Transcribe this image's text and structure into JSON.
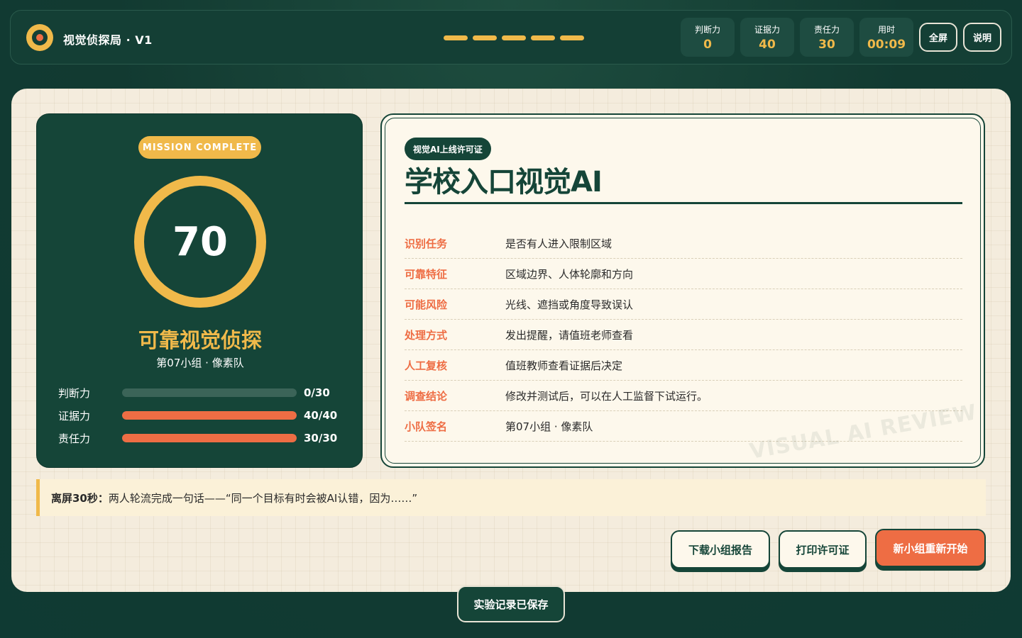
{
  "header": {
    "app_title": "视觉侦探局 · V1",
    "progress_steps": 5,
    "stats": [
      {
        "label": "判断力",
        "value": "0"
      },
      {
        "label": "证据力",
        "value": "40"
      },
      {
        "label": "责任力",
        "value": "30"
      },
      {
        "label": "用时",
        "value": "00:09"
      }
    ],
    "fullscreen_label": "全屏",
    "help_label": "说明"
  },
  "score_panel": {
    "badge": "MISSION COMPLETE",
    "score": "70",
    "score_fraction": 0.7,
    "rank_title": "可靠视觉侦探",
    "team_line": "第07小组 · 像素队",
    "bars": [
      {
        "label": "判断力",
        "value": 0,
        "max": 30,
        "text": "0/30"
      },
      {
        "label": "证据力",
        "value": 40,
        "max": 40,
        "text": "40/40"
      },
      {
        "label": "责任力",
        "value": 30,
        "max": 30,
        "text": "30/30"
      }
    ]
  },
  "license": {
    "badge": "视觉AI上线许可证",
    "title": "学校入口视觉AI",
    "rows": [
      {
        "key": "识别任务",
        "value": "是否有人进入限制区域"
      },
      {
        "key": "可靠特征",
        "value": "区域边界、人体轮廓和方向"
      },
      {
        "key": "可能风险",
        "value": "光线、遮挡或角度导致误认"
      },
      {
        "key": "处理方式",
        "value": "发出提醒，请值班老师查看"
      },
      {
        "key": "人工复核",
        "value": "值班教师查看证据后决定"
      },
      {
        "key": "调查结论",
        "value": "修改并测试后，可以在人工监督下试运行。"
      },
      {
        "key": "小队签名",
        "value": "第07小组 · 像素队"
      }
    ],
    "watermark": "VISUAL AI REVIEW"
  },
  "tip": {
    "label": "离屏30秒：",
    "text": "两人轮流完成一句话——“同一个目标有时会被AI认错，因为……”"
  },
  "actions": {
    "download": "下载小组报告",
    "print": "打印许可证",
    "restart": "新小组重新开始"
  },
  "toast": "实验记录已保存",
  "colors": {
    "accent_yellow": "#f0b94a",
    "accent_orange": "#ee6d44",
    "dark_green": "#154538",
    "paper": "#f4ecdd"
  }
}
